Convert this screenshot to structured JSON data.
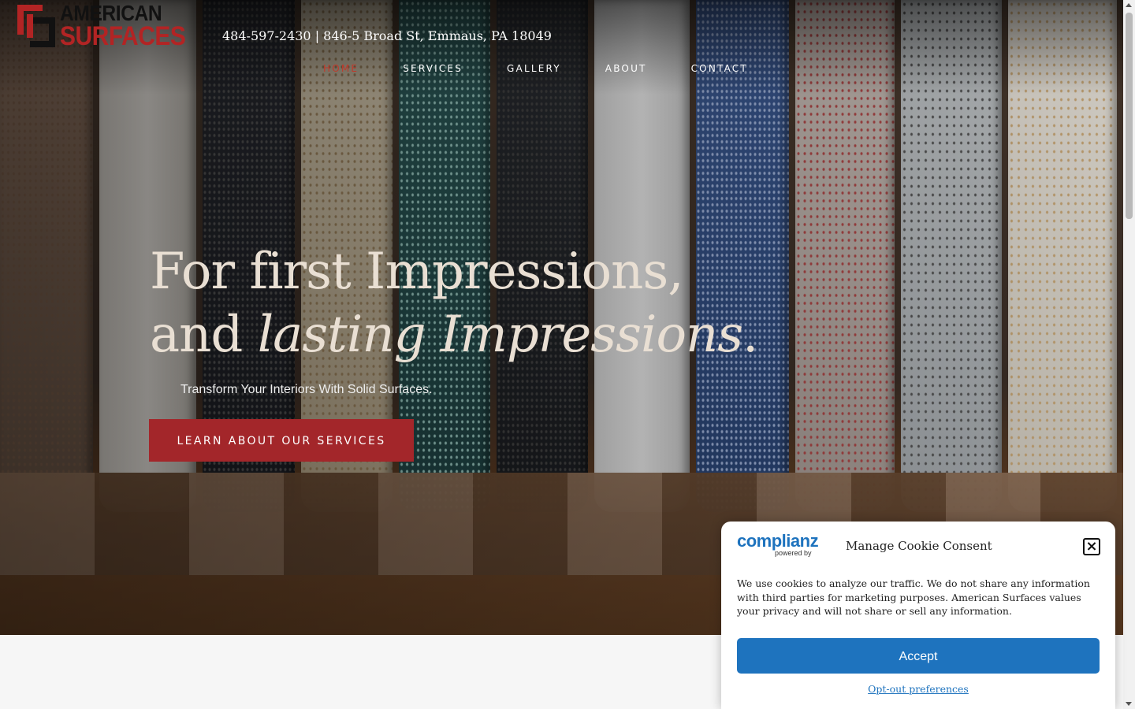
{
  "brand": {
    "name_line1": "AMERICAN",
    "name_line2": "SURFACES",
    "colors": {
      "red": "#b22424",
      "black": "#111111"
    }
  },
  "header": {
    "contact_line": "484-597-2430 | 846-5 Broad St, Emmaus, PA 18049"
  },
  "nav": {
    "items": [
      {
        "label": "HOME",
        "active": true
      },
      {
        "label": "SERVICES",
        "active": false
      },
      {
        "label": "GALLERY",
        "active": false
      },
      {
        "label": "ABOUT",
        "active": false
      },
      {
        "label": "CONTACT",
        "active": false
      }
    ],
    "active_color": "#c0392b"
  },
  "hero": {
    "headline_line1": "For first Impressions,",
    "headline_line2_plain": "and ",
    "headline_line2_italic": "lasting Impressions",
    "headline_line2_end": ".",
    "subtitle": "Transform Your Interiors With Solid Surfaces.",
    "cta_label": "LEARN ABOUT OUR SERVICES",
    "cta_color": "#a3262a"
  },
  "cookie_banner": {
    "brand": "complianz",
    "powered_by": "powered by",
    "title": "Manage Cookie Consent",
    "close_icon": "close-icon",
    "body": "We use cookies to analyze our traffic. We do not share any information with third parties for marketing purposes. American Surfaces values your privacy and will not share or sell any information.",
    "accept_label": "Accept",
    "optout_label": "Opt-out preferences",
    "accent": "#1e73be"
  }
}
